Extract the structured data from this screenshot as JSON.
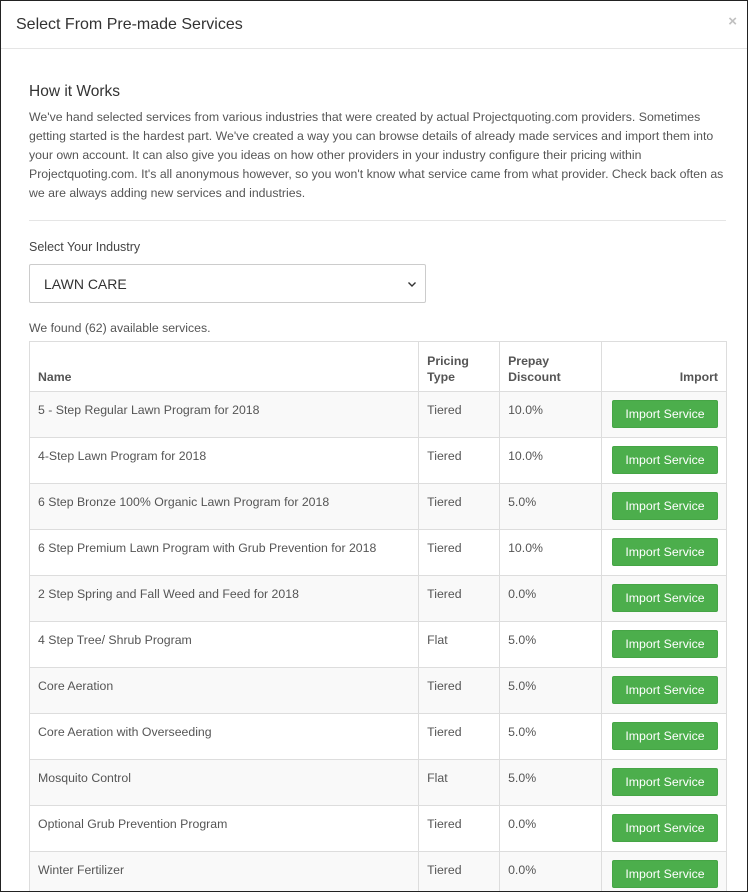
{
  "modal": {
    "title": "Select From Pre-made Services",
    "close_label": "×"
  },
  "how_it_works": {
    "title": "How it Works",
    "text": "We've hand selected services from various industries that were created by actual Projectquoting.com providers. Sometimes getting started is the hardest part. We've created a way you can browse details of already made services and import them into your own account. It can also give you ideas on how other providers in your industry configure their pricing within Projectquoting.com. It's all anonymous however, so you won't know what service came from what provider. Check back often as we are always adding new services and industries."
  },
  "industry": {
    "label": "Select Your Industry",
    "selected": "LAWN CARE",
    "icon": "chevron-down-icon"
  },
  "results": {
    "found_text": "We found (62) available services."
  },
  "table": {
    "headers": {
      "name": "Name",
      "pricing_type_line1": "Pricing",
      "pricing_type_line2": "Type",
      "prepay_line1": "Prepay",
      "prepay_line2": "Discount",
      "import": "Import"
    },
    "button_label": "Import Service",
    "rows": [
      {
        "name": "5 - Step Regular Lawn Program for 2018",
        "pricing": "Tiered",
        "discount": "10.0%"
      },
      {
        "name": "4-Step Lawn Program for 2018",
        "pricing": "Tiered",
        "discount": "10.0%"
      },
      {
        "name": "6 Step Bronze 100% Organic Lawn Program for 2018",
        "pricing": "Tiered",
        "discount": "5.0%"
      },
      {
        "name": "6 Step Premium Lawn Program with Grub Prevention for 2018",
        "pricing": "Tiered",
        "discount": "10.0%"
      },
      {
        "name": "2 Step Spring and Fall Weed and Feed for 2018",
        "pricing": "Tiered",
        "discount": "0.0%"
      },
      {
        "name": "4 Step Tree/ Shrub Program",
        "pricing": "Flat",
        "discount": "5.0%"
      },
      {
        "name": "Core Aeration",
        "pricing": "Tiered",
        "discount": "5.0%"
      },
      {
        "name": "Core Aeration with Overseeding",
        "pricing": "Tiered",
        "discount": "5.0%"
      },
      {
        "name": "Mosquito Control",
        "pricing": "Flat",
        "discount": "5.0%"
      },
      {
        "name": "Optional Grub Prevention Program",
        "pricing": "Tiered",
        "discount": "0.0%"
      },
      {
        "name": "Winter Fertilizer",
        "pricing": "Tiered",
        "discount": "0.0%"
      }
    ]
  }
}
